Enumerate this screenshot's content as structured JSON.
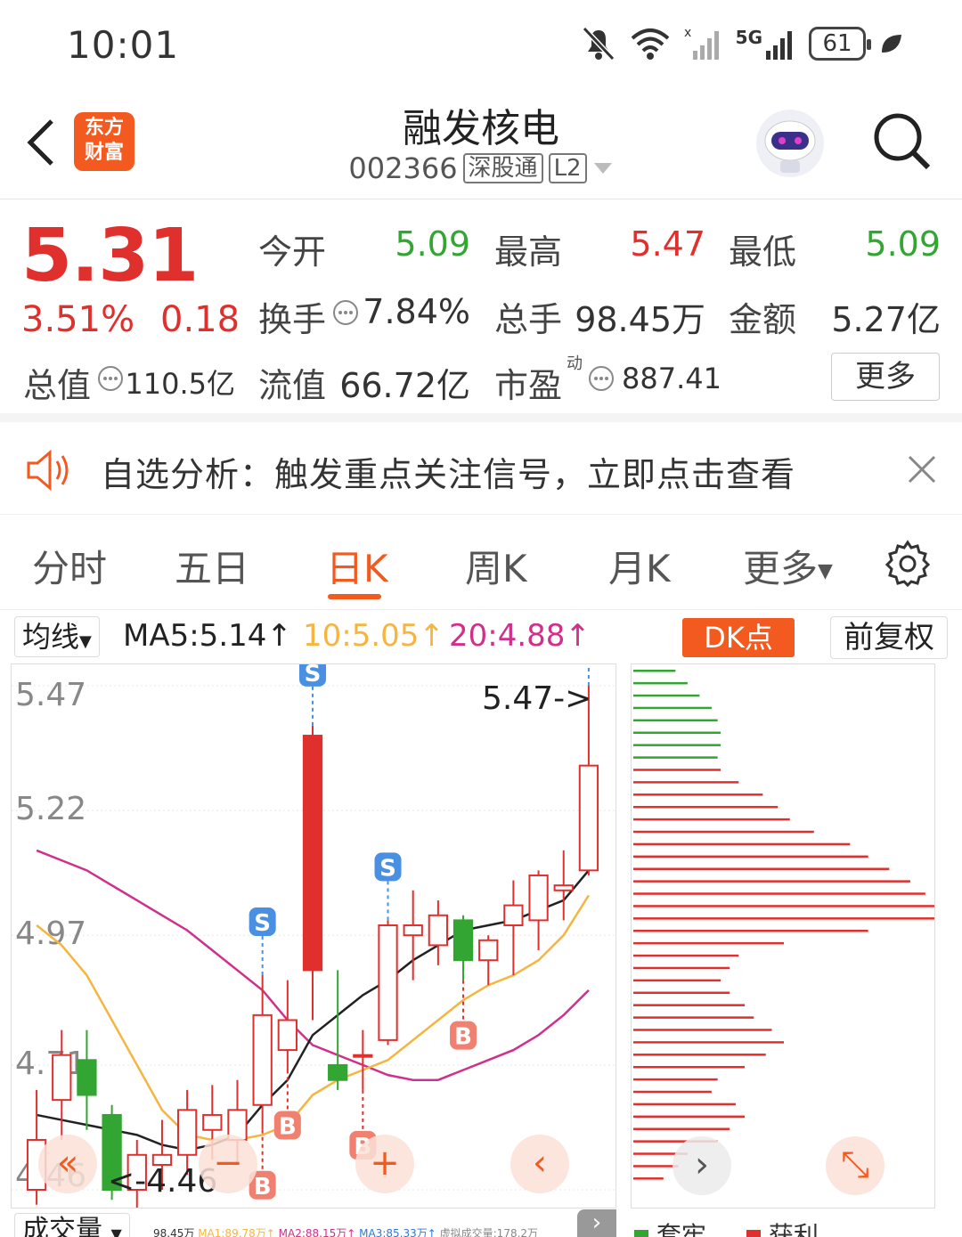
{
  "status": {
    "time": "10:01",
    "battery": "61",
    "network": "5G"
  },
  "header": {
    "name": "融发核电",
    "code": "002366",
    "tag1": "深股通",
    "tag2": "L2",
    "logo_line1": "东方",
    "logo_line2": "财富",
    "back_icon": "chevron-left-icon",
    "search_icon": "search-icon",
    "avatar_icon": "robot-avatar-icon"
  },
  "quote": {
    "price": "5.31",
    "pct": "3.51%",
    "chg": "0.18",
    "open_label": "今开",
    "open": "5.09",
    "high_label": "最高",
    "high": "5.47",
    "low_label": "最低",
    "low": "5.09",
    "turnover_label": "换手",
    "turnover": "7.84%",
    "volume_label": "总手",
    "volume": "98.45万",
    "amount_label": "金额",
    "amount": "5.27亿",
    "mcap_label": "总值",
    "mcap": "110.5亿",
    "float_label": "流值",
    "float": "66.72亿",
    "pe_label": "市盈",
    "pe_sup": "动",
    "pe": "887.41",
    "more": "更多",
    "colors": {
      "up": "#e0302e",
      "down": "#33a532"
    }
  },
  "notice": {
    "text": "自选分析：触发重点关注信号，立即点击查看",
    "close_icon": "close-icon",
    "speaker_icon": "speaker-icon"
  },
  "tabs": {
    "t1": "分时",
    "t2": "五日",
    "t3": "日K",
    "t4": "周K",
    "t5": "月K",
    "t6": "更多",
    "active": "日K"
  },
  "ma": {
    "selector": "均线",
    "ma5": "MA5:5.14",
    "ma10": "10:5.05",
    "ma20": "20:4.88",
    "ma5_color": "#222",
    "ma10_color": "#f5b540",
    "ma20_color": "#d0308c",
    "dk": "DK点",
    "fq": "前复权"
  },
  "chart_data": {
    "type": "candlestick",
    "ylim": [
      4.46,
      5.47
    ],
    "yticks": [
      "5.47",
      "5.22",
      "4.97",
      "4.71",
      "4.46"
    ],
    "max_label": "5.47->",
    "min_label": "<-4.46",
    "candles": [
      {
        "o": 4.46,
        "h": 4.66,
        "l": 4.43,
        "c": 4.56
      },
      {
        "o": 4.64,
        "h": 4.78,
        "l": 4.56,
        "c": 4.73
      },
      {
        "o": 4.72,
        "h": 4.78,
        "l": 4.58,
        "c": 4.65
      },
      {
        "o": 4.61,
        "h": 4.63,
        "l": 4.44,
        "c": 4.46
      },
      {
        "o": 4.46,
        "h": 4.56,
        "l": 4.42,
        "c": 4.53
      },
      {
        "o": 4.51,
        "h": 4.6,
        "l": 4.46,
        "c": 4.53
      },
      {
        "o": 4.53,
        "h": 4.66,
        "l": 4.49,
        "c": 4.62
      },
      {
        "o": 4.58,
        "h": 4.67,
        "l": 4.52,
        "c": 4.61
      },
      {
        "o": 4.56,
        "h": 4.68,
        "l": 4.51,
        "c": 4.62
      },
      {
        "o": 4.63,
        "h": 4.89,
        "l": 4.58,
        "c": 4.81
      },
      {
        "o": 4.74,
        "h": 4.88,
        "l": 4.7,
        "c": 4.8
      },
      {
        "o": 4.9,
        "h": 5.39,
        "l": 4.8,
        "c": 5.37
      },
      {
        "o": 4.71,
        "h": 4.9,
        "l": 4.66,
        "c": 4.68
      },
      {
        "o": 4.73,
        "h": 4.78,
        "l": 4.66,
        "c": 4.73
      },
      {
        "o": 4.76,
        "h": 5.0,
        "l": 4.75,
        "c": 4.99
      },
      {
        "o": 4.97,
        "h": 5.06,
        "l": 4.88,
        "c": 4.99
      },
      {
        "o": 4.95,
        "h": 5.04,
        "l": 4.91,
        "c": 5.01
      },
      {
        "o": 5.0,
        "h": 5.01,
        "l": 4.88,
        "c": 4.92
      },
      {
        "o": 4.92,
        "h": 4.97,
        "l": 4.87,
        "c": 4.96
      },
      {
        "o": 4.99,
        "h": 5.08,
        "l": 4.89,
        "c": 5.03
      },
      {
        "o": 5.0,
        "h": 5.1,
        "l": 4.94,
        "c": 5.09
      },
      {
        "o": 5.06,
        "h": 5.14,
        "l": 5.0,
        "c": 5.07
      },
      {
        "o": 5.1,
        "h": 5.47,
        "l": 5.09,
        "c": 5.31
      }
    ],
    "ma5": [
      4.61,
      4.6,
      4.59,
      4.58,
      4.57,
      4.55,
      4.54,
      4.55,
      4.57,
      4.63,
      4.68,
      4.77,
      4.81,
      4.85,
      4.88,
      4.92,
      4.95,
      4.98,
      4.99,
      5.0,
      5.02,
      5.04,
      5.1
    ],
    "ma10": [
      4.99,
      4.95,
      4.89,
      4.8,
      4.71,
      4.62,
      4.57,
      4.56,
      4.56,
      4.57,
      4.59,
      4.65,
      4.68,
      4.7,
      4.72,
      4.76,
      4.8,
      4.84,
      4.87,
      4.89,
      4.92,
      4.97,
      5.05
    ],
    "ma20": [
      5.14,
      5.12,
      5.1,
      5.07,
      5.04,
      5.01,
      4.98,
      4.94,
      4.9,
      4.86,
      4.8,
      4.75,
      4.73,
      4.71,
      4.69,
      4.68,
      4.68,
      4.7,
      4.72,
      4.74,
      4.77,
      4.81,
      4.86
    ],
    "signals": [
      {
        "i": 9,
        "t": "B"
      },
      {
        "i": 10,
        "t": "B"
      },
      {
        "i": 9,
        "t": "S"
      },
      {
        "i": 11,
        "t": "S"
      },
      {
        "i": 14,
        "t": "S"
      },
      {
        "i": 17,
        "t": "B"
      },
      {
        "i": 13,
        "t": "B"
      },
      {
        "i": 22,
        "t": "S"
      }
    ],
    "profile_bars": [
      {
        "v": 0.14,
        "g": true
      },
      {
        "v": 0.18,
        "g": true
      },
      {
        "v": 0.22,
        "g": true
      },
      {
        "v": 0.26,
        "g": true
      },
      {
        "v": 0.28,
        "g": true
      },
      {
        "v": 0.29,
        "g": true
      },
      {
        "v": 0.29,
        "g": true
      },
      {
        "v": 0.28,
        "g": true
      },
      {
        "v": 0.29,
        "g": false
      },
      {
        "v": 0.35,
        "g": false
      },
      {
        "v": 0.43,
        "g": false
      },
      {
        "v": 0.48,
        "g": false
      },
      {
        "v": 0.52,
        "g": false
      },
      {
        "v": 0.6,
        "g": false
      },
      {
        "v": 0.72,
        "g": false
      },
      {
        "v": 0.78,
        "g": false
      },
      {
        "v": 0.85,
        "g": false
      },
      {
        "v": 0.92,
        "g": false
      },
      {
        "v": 0.97,
        "g": false
      },
      {
        "v": 1.0,
        "g": false
      },
      {
        "v": 1.0,
        "g": false
      },
      {
        "v": 0.78,
        "g": false
      },
      {
        "v": 0.5,
        "g": false
      },
      {
        "v": 0.35,
        "g": false
      },
      {
        "v": 0.32,
        "g": false
      },
      {
        "v": 0.29,
        "g": false
      },
      {
        "v": 0.32,
        "g": false
      },
      {
        "v": 0.37,
        "g": false
      },
      {
        "v": 0.4,
        "g": false
      },
      {
        "v": 0.46,
        "g": false
      },
      {
        "v": 0.5,
        "g": false
      },
      {
        "v": 0.44,
        "g": false
      },
      {
        "v": 0.37,
        "g": false
      },
      {
        "v": 0.28,
        "g": false
      },
      {
        "v": 0.26,
        "g": false
      },
      {
        "v": 0.34,
        "g": false
      },
      {
        "v": 0.37,
        "g": false
      },
      {
        "v": 0.32,
        "g": false
      },
      {
        "v": 0.28,
        "g": false
      },
      {
        "v": 0.18,
        "g": false
      },
      {
        "v": 0.15,
        "g": false
      },
      {
        "v": 0.1,
        "g": false
      }
    ],
    "profile_legend": [
      "套牢",
      "获利"
    ]
  },
  "bottom": {
    "vol_selector": "成交量",
    "vol": "98.45万",
    "ma1": "MA1:89.78万↑",
    "ma2": "MA2:88.15万↑",
    "ma3": "MA3:85.33万↑",
    "virtual": "虚拟成交量:178.2万"
  }
}
